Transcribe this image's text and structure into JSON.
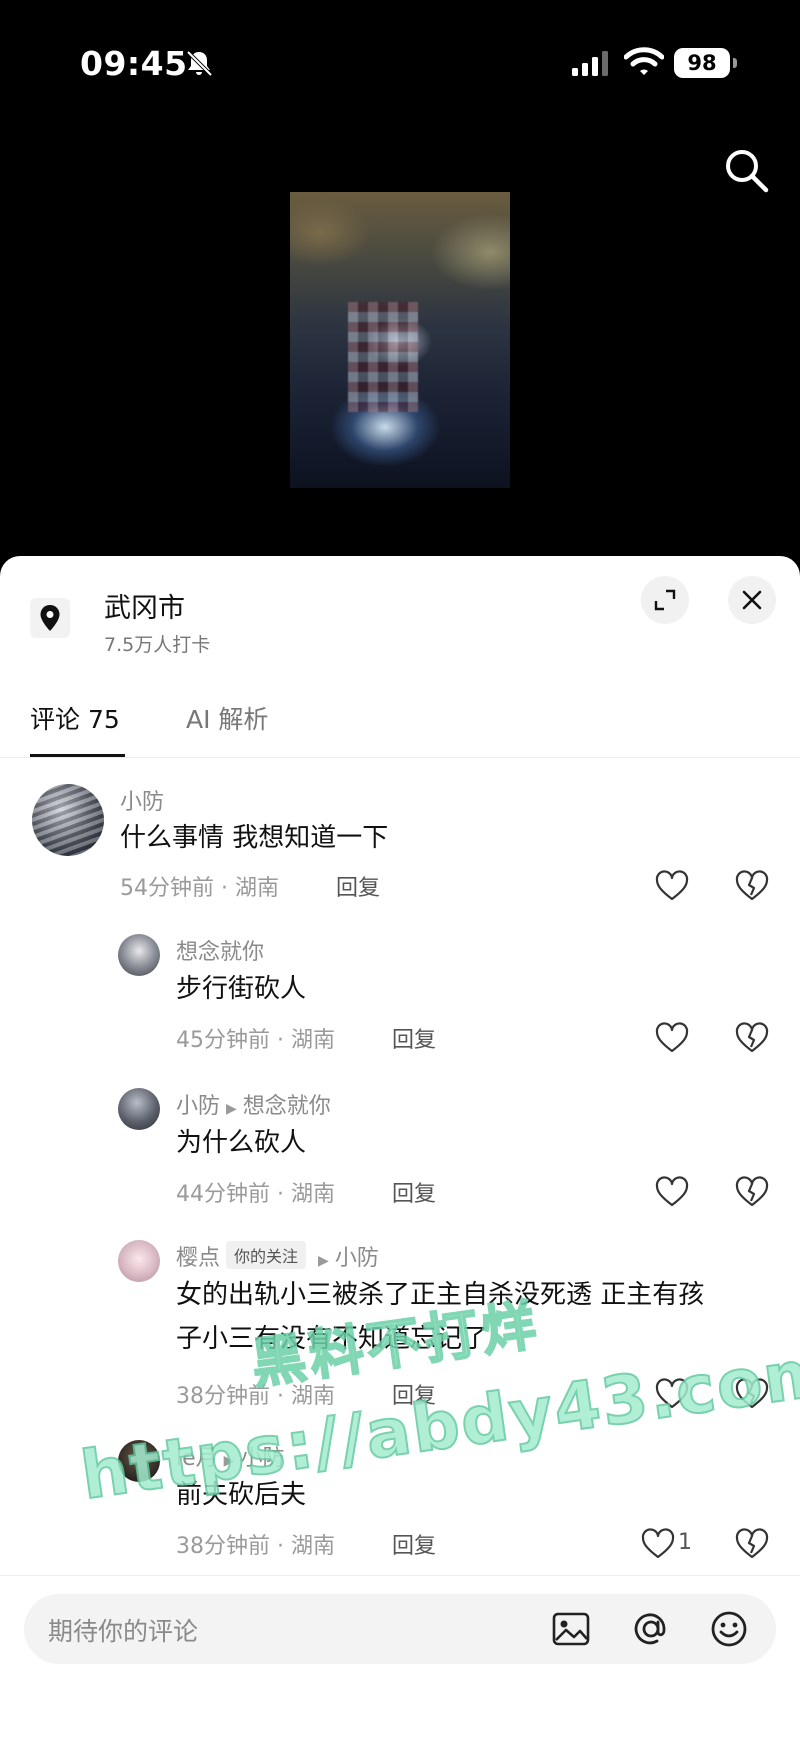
{
  "status_bar": {
    "time": "09:45",
    "battery": "98"
  },
  "location": {
    "title": "武冈市",
    "subtitle": "7.5万人打卡"
  },
  "tabs": [
    {
      "label": "评论 75",
      "active": true
    },
    {
      "label": "AI 解析",
      "active": false
    }
  ],
  "comments": [
    {
      "author": "小防",
      "text": "什么事情 我想知道一下",
      "meta": "54分钟前 · 湖南",
      "reply_label": "回复",
      "likes": ""
    },
    {
      "author": "想念就你",
      "text": "步行街砍人",
      "meta": "45分钟前 · 湖南",
      "reply_label": "回复",
      "likes": ""
    },
    {
      "author": "小防",
      "reply_to": "想念就你",
      "text": "为什么砍人",
      "meta": "44分钟前 · 湖南",
      "reply_label": "回复",
      "likes": ""
    },
    {
      "author": "樱点",
      "badge": "你的关注",
      "reply_to": "小防",
      "text_line1": "女的出轨小三被杀了正主自杀没死透 正主有孩",
      "text_line2": "子小三有没有不知道忘记了",
      "meta": "38分钟前 · 湖南",
      "reply_label": "回复",
      "likes": ""
    },
    {
      "author": "le月",
      "reply_to": "小防",
      "text": "前夫砍后夫",
      "meta": "38分钟前 · 湖南",
      "reply_label": "回复",
      "likes": "1"
    }
  ],
  "watermark": {
    "line1": "黑料不打烊",
    "line2": "https://abdy43.com"
  },
  "input": {
    "placeholder": "期待你的评论"
  },
  "icons": [
    "bell-slash-icon",
    "signal-icon",
    "wifi-icon",
    "search-icon",
    "location-pin-icon",
    "expand-icon",
    "close-icon",
    "heart-icon",
    "broken-heart-icon",
    "image-icon",
    "at-icon",
    "emoji-icon"
  ]
}
